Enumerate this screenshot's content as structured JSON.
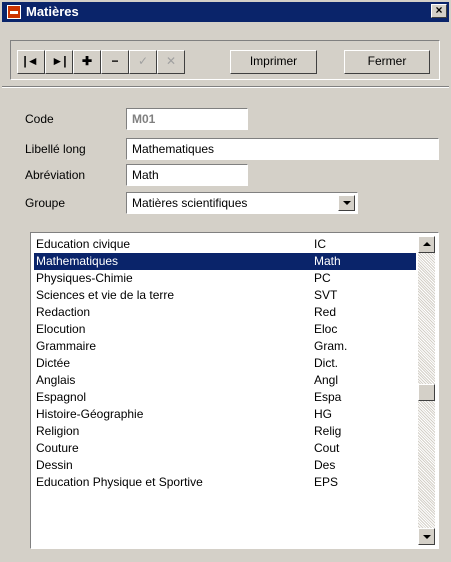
{
  "window": {
    "title": "Matières",
    "close_glyph": "×"
  },
  "toolbar": {
    "first_icon": "first-record-icon",
    "last_icon": "last-record-icon",
    "add_icon": "plus-icon",
    "delete_icon": "minus-icon",
    "validate_icon": "checkmark-icon",
    "cancel_icon": "cancel-icon",
    "first": "|◄",
    "last": "►|",
    "add": "✚",
    "delete": "−",
    "validate": "✓",
    "cancel": "✕",
    "print_label": "Imprimer",
    "close_label": "Fermer"
  },
  "form": {
    "code_label": "Code",
    "code_value": "M01",
    "libelle_label": "Libellé long",
    "libelle_value": "Mathematiques",
    "abreviation_label": "Abréviation",
    "abreviation_value": "Math",
    "groupe_label": "Groupe",
    "groupe_value": "Matières scientifiques"
  },
  "list": {
    "rows": [
      {
        "name": "Education civique",
        "abbr": "IC"
      },
      {
        "name": "Mathematiques",
        "abbr": "Math",
        "selected": true
      },
      {
        "name": "Physiques-Chimie",
        "abbr": "PC"
      },
      {
        "name": "Sciences et vie de  la terre",
        "abbr": "SVT"
      },
      {
        "name": "Redaction",
        "abbr": "Red"
      },
      {
        "name": "Elocution",
        "abbr": "Eloc"
      },
      {
        "name": "Grammaire",
        "abbr": "Gram."
      },
      {
        "name": "Dictée",
        "abbr": "Dict."
      },
      {
        "name": "Anglais",
        "abbr": "Angl"
      },
      {
        "name": "Espagnol",
        "abbr": "Espa"
      },
      {
        "name": "Histoire-Géographie",
        "abbr": "HG"
      },
      {
        "name": "Religion",
        "abbr": "Relig"
      },
      {
        "name": "Couture",
        "abbr": "Cout"
      },
      {
        "name": "Dessin",
        "abbr": "Des"
      },
      {
        "name": "Education Physique et Sportive",
        "abbr": "EPS"
      }
    ]
  },
  "colors": {
    "selection": "#0a246a",
    "face": "#d4d0c8"
  }
}
